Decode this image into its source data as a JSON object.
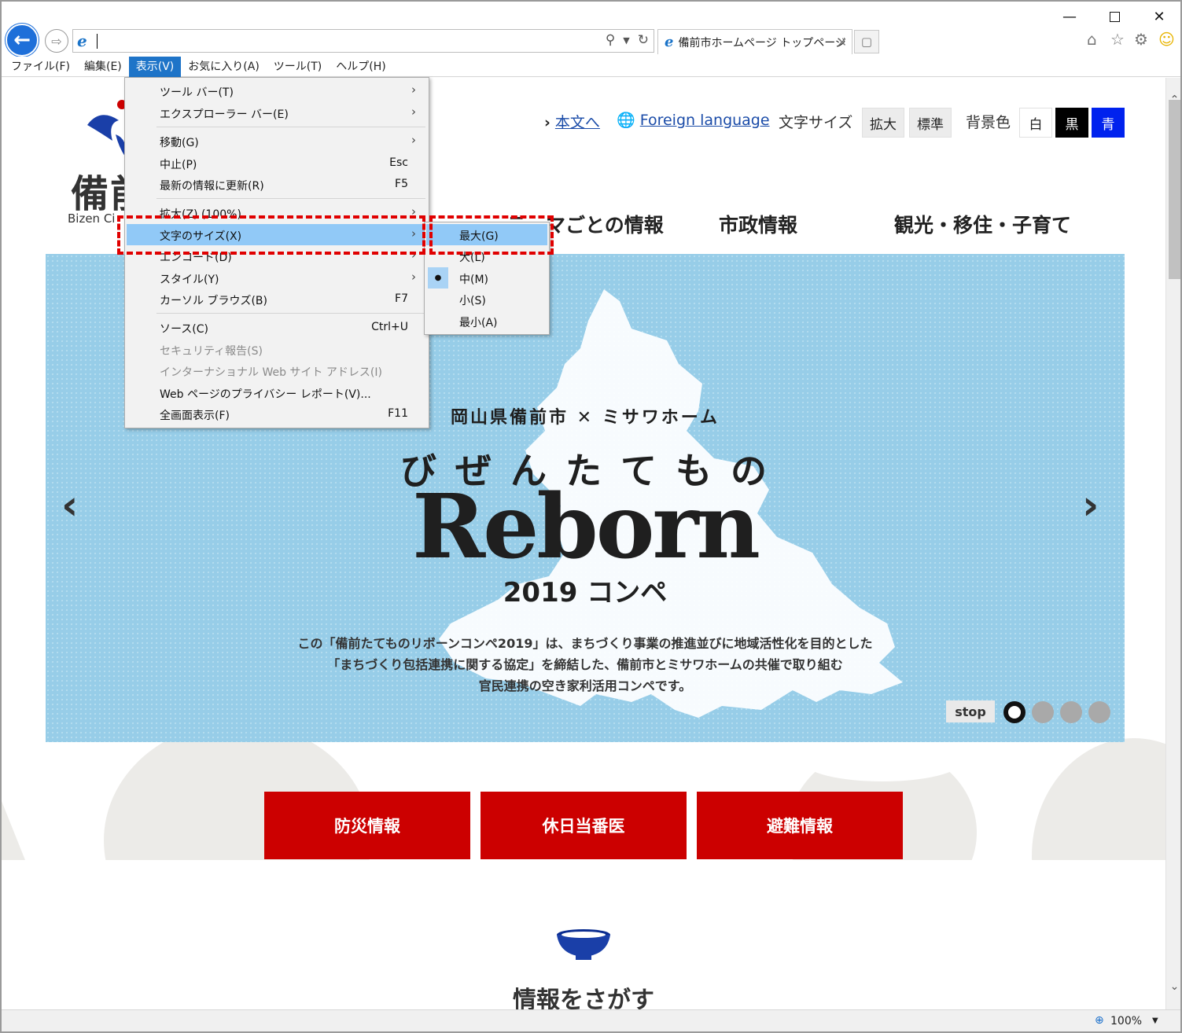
{
  "browser": {
    "address": "",
    "tab_title": "備前市ホームページ トップページ",
    "menu": [
      "ファイル(F)",
      "編集(E)",
      "表示(V)",
      "お気に入り(A)",
      "ツール(T)",
      "ヘルプ(H)"
    ],
    "active_menu_index": 2,
    "zoom": "100%"
  },
  "view_menu": {
    "items": [
      {
        "label": "ツール バー(T)",
        "shortcut": "",
        "submenu": true,
        "disabled": false
      },
      {
        "label": "エクスプローラー バー(E)",
        "shortcut": "",
        "submenu": true,
        "disabled": false
      },
      {
        "label": "移動(G)",
        "shortcut": "",
        "submenu": true,
        "disabled": false
      },
      {
        "label": "中止(P)",
        "shortcut": "Esc",
        "submenu": false,
        "disabled": false
      },
      {
        "label": "最新の情報に更新(R)",
        "shortcut": "F5",
        "submenu": false,
        "disabled": false
      },
      {
        "label": "拡大(Z) (100%)",
        "shortcut": "",
        "submenu": true,
        "disabled": false
      },
      {
        "label": "文字のサイズ(X)",
        "shortcut": "",
        "submenu": true,
        "disabled": false
      },
      {
        "label": "エンコード(D)",
        "shortcut": "",
        "submenu": true,
        "disabled": false
      },
      {
        "label": "スタイル(Y)",
        "shortcut": "",
        "submenu": true,
        "disabled": false
      },
      {
        "label": "カーソル ブラウズ(B)",
        "shortcut": "F7",
        "submenu": false,
        "disabled": false
      },
      {
        "label": "ソース(C)",
        "shortcut": "Ctrl+U",
        "submenu": false,
        "disabled": false
      },
      {
        "label": "セキュリティ報告(S)",
        "shortcut": "",
        "submenu": false,
        "disabled": true
      },
      {
        "label": "インターナショナル Web サイト アドレス(I)",
        "shortcut": "",
        "submenu": false,
        "disabled": true
      },
      {
        "label": "Web ページのプライバシー レポート(V)...",
        "shortcut": "",
        "submenu": false,
        "disabled": false
      },
      {
        "label": "全画面表示(F)",
        "shortcut": "F11",
        "submenu": false,
        "disabled": false
      }
    ],
    "highlighted_index": 6
  },
  "text_size_menu": {
    "items": [
      "最大(G)",
      "大(L)",
      "中(M)",
      "小(S)",
      "最小(A)"
    ],
    "highlighted_index": 0,
    "selected_index": 2
  },
  "site": {
    "logo_text": "備前",
    "logo_sub": "Bizen Ci",
    "skip_link": "本文へ",
    "foreign_link": "Foreign language",
    "font_size_label": "文字サイズ",
    "font_size_buttons": [
      "拡大",
      "標準"
    ],
    "bg_color_label": "背景色",
    "bg_color_buttons": [
      "白",
      "黒",
      "青"
    ],
    "nav": [
      "テーマごとの情報",
      "市政情報",
      "観光・移住・子育て"
    ],
    "hero": {
      "subtitle": "岡山県備前市 ✕ ミサワホーム",
      "title_kana": "び ぜ ん た て も の",
      "title": "Reborn",
      "year": "2019 コンペ",
      "desc": [
        "この「備前たてものリボーンコンペ2019」は、まちづくり事業の推進並びに地域活性化を目的とした",
        "「まちづくり包括連携に関する協定」を締結した、備前市とミサワホームの共催で取り組む",
        "官民連携の空き家利活用コンペです。"
      ],
      "stop": "stop",
      "slide_count": 4,
      "active_slide": 0
    },
    "quick_buttons": [
      "防災情報",
      "休日当番医",
      "避難情報"
    ],
    "search_heading": "情報をさがす"
  },
  "colors": {
    "accent_blue": "#1e74c8",
    "highlight": "#91c9f7",
    "annotation_red": "#e00000",
    "site_red": "#cc0000",
    "hero_blue": "#97cde8"
  }
}
